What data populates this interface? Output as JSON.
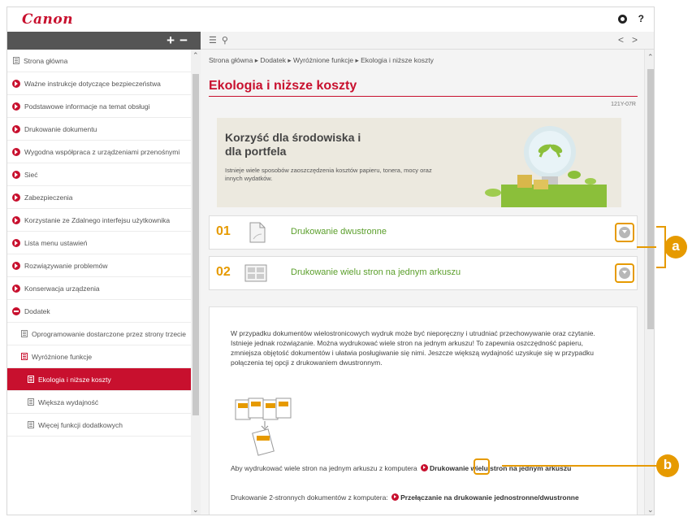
{
  "brand": "Canon",
  "topbar": {
    "help_label": "?"
  },
  "sidebar": {
    "toolbar": {
      "expand_label": "+",
      "collapse_label": "−"
    },
    "items": [
      {
        "label": "Strona główna",
        "icon": "book-icon"
      },
      {
        "label": "Ważne instrukcje dotyczące bezpieczeństwa",
        "icon": "red-arrow-icon"
      },
      {
        "label": "Podstawowe informacje na temat obsługi",
        "icon": "red-arrow-icon"
      },
      {
        "label": "Drukowanie dokumentu",
        "icon": "red-arrow-icon"
      },
      {
        "label": "Wygodna współpraca z urządzeniami przenośnymi",
        "icon": "red-arrow-icon"
      },
      {
        "label": "Sieć",
        "icon": "red-arrow-icon"
      },
      {
        "label": "Zabezpieczenia",
        "icon": "red-arrow-icon"
      },
      {
        "label": "Korzystanie ze Zdalnego interfejsu użytkownika",
        "icon": "red-arrow-icon"
      },
      {
        "label": "Lista menu ustawień",
        "icon": "red-arrow-icon"
      },
      {
        "label": "Rozwiązywanie problemów",
        "icon": "red-arrow-icon"
      },
      {
        "label": "Konserwacja urządzenia",
        "icon": "red-arrow-icon"
      },
      {
        "label": "Dodatek",
        "icon": "red-minus-icon"
      },
      {
        "label": "Oprogramowanie dostarczone przez strony trzecie",
        "icon": "book-icon"
      },
      {
        "label": "Wyróżnione funkcje",
        "icon": "red-book-icon"
      },
      {
        "label": "Ekologia i niższe koszty",
        "icon": "book-icon",
        "active": true
      },
      {
        "label": "Większa wydajność",
        "icon": "book-icon"
      },
      {
        "label": "Więcej funkcji dodatkowych",
        "icon": "book-icon"
      }
    ]
  },
  "content": {
    "toolbar": {
      "back_label": "<",
      "forward_label": ">"
    },
    "breadcrumb": "Strona główna ▸ Dodatek ▸ Wyróżnione funkcje ▸ Ekologia i niższe koszty",
    "title": "Ekologia i niższe koszty",
    "doc_id": "121Y-07R",
    "banner": {
      "title_line1": "Korzyść dla środowiska i",
      "title_line2": "dla portfela",
      "desc": "Istnieje wiele sposobów zaoszczędzenia kosztów papieru, tonera, mocy oraz innych wydatków."
    },
    "items": [
      {
        "num": "01",
        "label": "Drukowanie dwustronne"
      },
      {
        "num": "02",
        "label": "Drukowanie wielu stron na jednym arkuszu"
      }
    ],
    "panel": {
      "paragraph": "W przypadku dokumentów wielostronicowych wydruk może być nieporęczny i utrudniać przechowywanie oraz czytanie. Istnieje jednak rozwiązanie. Można wydrukować wiele stron na jednym arkuszu! To zapewnia oszczędność papieru, zmniejsza objętość dokumentów i ułatwia posługiwanie się nimi. Jeszcze większą wydajność uzyskuje się w przypadku połączenia tej opcji z drukowaniem dwustronnym.",
      "link1_prefix": "Aby wydrukować wiele stron na jednym arkuszu z komputera",
      "link1_text": "Drukowanie wielu stron na jednym arkuszu",
      "link2_prefix": "Drukowanie 2-stronnych dokumentów z komputera:",
      "link2_text": "Przełączanie na drukowanie jednostronne/dwustronne"
    },
    "callouts": {
      "a": "a",
      "b": "b"
    }
  },
  "colors": {
    "accent": "#c8102e",
    "highlight": "#e69a00",
    "link_green": "#5a9e2a"
  }
}
